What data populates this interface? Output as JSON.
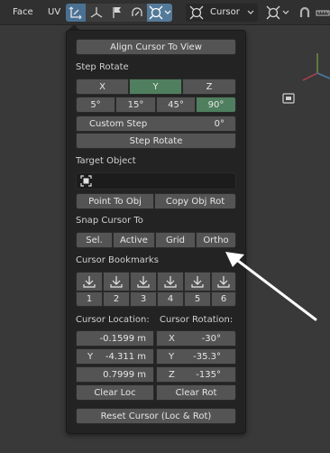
{
  "header": {
    "mode_face": "Face",
    "mode_uv": "UV",
    "cursor_menu": "Cursor"
  },
  "panel": {
    "align_cursor_to_view": "Align Cursor To View",
    "step_rotate_title": "Step Rotate",
    "axes": [
      "X",
      "Y",
      "Z"
    ],
    "axis_selected": "Y",
    "angles": [
      "5°",
      "15°",
      "45°",
      "90°"
    ],
    "angle_selected": "90°",
    "custom_step_label": "Custom Step",
    "custom_step_value": "0°",
    "step_rotate_button": "Step Rotate",
    "target_object_title": "Target Object",
    "point_to_obj": "Point To Obj",
    "copy_obj_rot": "Copy Obj Rot",
    "snap_cursor_title": "Snap Cursor To",
    "snap_options": [
      "Sel.",
      "Active",
      "Grid",
      "Ortho"
    ],
    "bookmarks_title": "Cursor Bookmarks",
    "bookmark_numbers": [
      "1",
      "2",
      "3",
      "4",
      "5",
      "6"
    ],
    "cursor_location_title": "Cursor Location:",
    "cursor_rotation_title": "Cursor Rotation:",
    "location": [
      {
        "label": "",
        "value": "-0.1599 m"
      },
      {
        "label": "Y",
        "value": "-4.311 m"
      },
      {
        "label": "",
        "value": "0.7999 m"
      }
    ],
    "rotation": [
      {
        "label": "X",
        "value": "-30°"
      },
      {
        "label": "Y",
        "value": "-35.3°"
      },
      {
        "label": "Z",
        "value": "-135°"
      }
    ],
    "clear_loc": "Clear Loc",
    "clear_rot": "Clear Rot",
    "reset_cursor": "Reset Cursor (Loc & Rot)"
  },
  "icons": {
    "move_tool": "move-icon",
    "snap_tool": "snap-icon",
    "cursor_tool": "cursor-icon",
    "bookmark": "download-arrow-icon",
    "arrow_annotation": "pointer-arrow"
  },
  "colors": {
    "panel_bg": "#232323",
    "button_bg": "#545454",
    "selected_green": "#4f7f5e",
    "active_blue": "#4a7193",
    "annotation_arrow": "#ffffff"
  }
}
